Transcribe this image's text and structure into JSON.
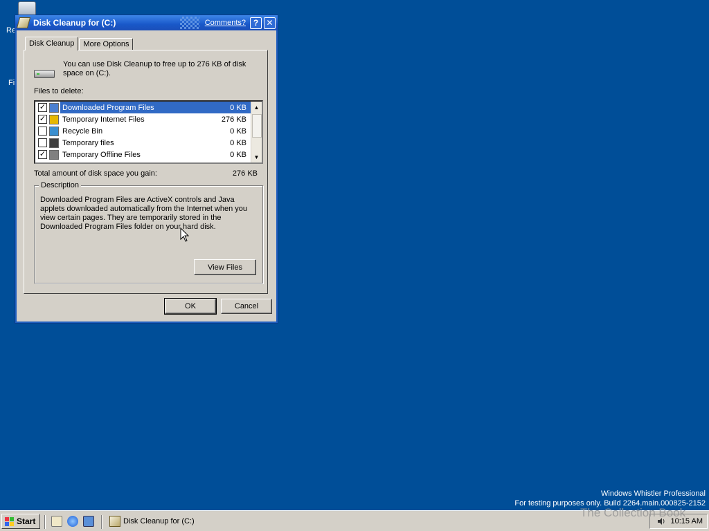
{
  "desktop": {
    "icons": [
      {
        "label": "Re"
      },
      {
        "label": "Fi"
      }
    ],
    "watermark_line1": "Windows Whistler Professional",
    "watermark_line2": "For testing purposes only. Build 2264.main.000825-2152",
    "overlay_text": "The Collection Book"
  },
  "dialog": {
    "title": "Disk Cleanup for  (C:)",
    "comments_link": "Comments?",
    "help_button": "?",
    "close_button": "✕",
    "tabs": [
      {
        "label": "Disk Cleanup",
        "active": true
      },
      {
        "label": "More Options",
        "active": false
      }
    ],
    "intro_text": "You can use Disk Cleanup to free up to 276 KB of disk space on  (C:).",
    "files_label": "Files to delete:",
    "files": [
      {
        "name": "Downloaded Program Files",
        "size": "0 KB",
        "checked": true,
        "selected": true,
        "icon_color": "#4a7fd0"
      },
      {
        "name": "Temporary Internet Files",
        "size": "276 KB",
        "checked": true,
        "selected": false,
        "icon_color": "#e6b800"
      },
      {
        "name": "Recycle Bin",
        "size": "0 KB",
        "checked": false,
        "selected": false,
        "icon_color": "#3a8fd0"
      },
      {
        "name": "Temporary files",
        "size": "0 KB",
        "checked": false,
        "selected": false,
        "icon_color": "#404040"
      },
      {
        "name": "Temporary Offline Files",
        "size": "0 KB",
        "checked": true,
        "selected": false,
        "icon_color": "#808080"
      }
    ],
    "total_label": "Total amount of disk space you gain:",
    "total_value": "276 KB",
    "description_legend": "Description",
    "description_text": "Downloaded Program Files are ActiveX controls and Java applets downloaded automatically from the Internet when you view certain pages. They are temporarily stored in the Downloaded Program Files folder on your hard disk.",
    "view_files_button": "View Files",
    "ok_button": "OK",
    "cancel_button": "Cancel"
  },
  "taskbar": {
    "start_label": "Start",
    "task_label": "Disk Cleanup for  (C:)",
    "clock": "10:15 AM"
  }
}
